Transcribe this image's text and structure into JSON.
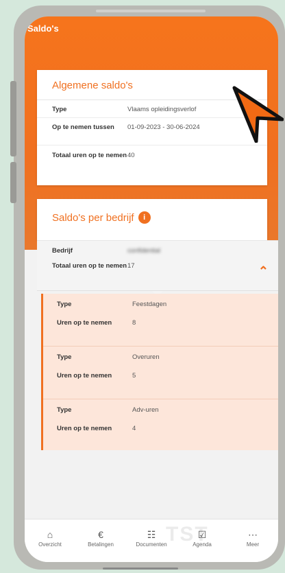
{
  "header": {
    "title": "Saldo's"
  },
  "general": {
    "title": "Algemene saldo's",
    "rows": [
      {
        "label": "Type",
        "value": "Vlaams opleidingsverlof"
      },
      {
        "label": "Op te nemen tussen",
        "value": "01-09-2023 - 30-06-2024"
      },
      {
        "label": "Totaal uren op te nemen",
        "value": "40"
      }
    ]
  },
  "per_company": {
    "title": "Saldo's per bedrijf",
    "info_badge": "i",
    "company_label": "Bedrijf",
    "company_value": "confidential",
    "total_label": "Totaal uren op te nemen",
    "total_value": "17",
    "breakdown": [
      {
        "type_label": "Type",
        "type_value": "Feestdagen",
        "hours_label": "Uren op te nemen",
        "hours_value": "8"
      },
      {
        "type_label": "Type",
        "type_value": "Overuren",
        "hours_label": "Uren op te nemen",
        "hours_value": "5"
      },
      {
        "type_label": "Type",
        "type_value": "Adv-uren",
        "hours_label": "Uren op te nemen",
        "hours_value": "4"
      }
    ]
  },
  "nav": [
    {
      "label": "Overzicht",
      "icon": "home-icon"
    },
    {
      "label": "Betalingen",
      "icon": "euro-icon"
    },
    {
      "label": "Documenten",
      "icon": "document-icon"
    },
    {
      "label": "Agenda",
      "icon": "calendar-icon"
    },
    {
      "label": "Meer",
      "icon": "more-icon"
    }
  ],
  "watermark": "TST",
  "colors": {
    "accent": "#f07020",
    "breakdown_bg": "#fde6da",
    "page_bg": "#d5e8dc"
  }
}
